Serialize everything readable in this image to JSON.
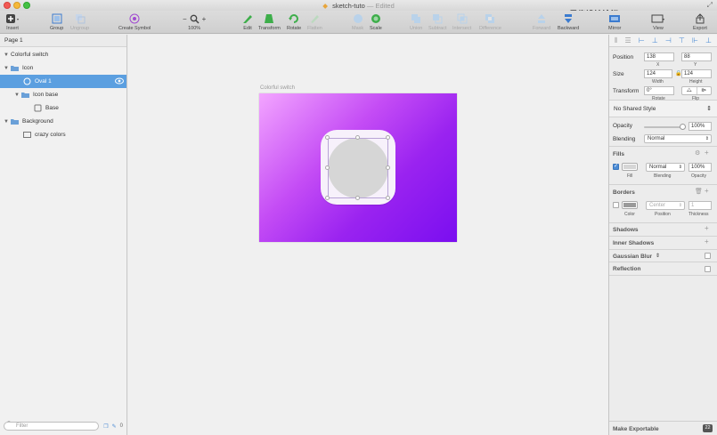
{
  "window": {
    "title": "sketch-tuto",
    "edited": "— Edited",
    "watermark": "思缘设计论坛  WWW.MISSYUAN.COM"
  },
  "toolbar": {
    "insert": "Insert",
    "group": "Group",
    "ungroup": "Ungroup",
    "create_symbol": "Create Symbol",
    "zoom_minus": "−",
    "zoom_plus": "+",
    "zoom": "100%",
    "edit": "Edit",
    "transform": "Transform",
    "rotate": "Rotate",
    "flatten": "Flatten",
    "mask": "Mask",
    "scale": "Scale",
    "union": "Union",
    "subtract": "Subtract",
    "intersect": "Intersect",
    "difference": "Difference",
    "forward": "Forward",
    "backward": "Backward",
    "mirror": "Mirror",
    "view": "View",
    "export": "Export"
  },
  "layers": {
    "page": "Page 1",
    "items": [
      {
        "label": "Colorful switch"
      },
      {
        "label": "Icon"
      },
      {
        "label": "Oval 1"
      },
      {
        "label": "Icon base"
      },
      {
        "label": "Base"
      },
      {
        "label": "Background"
      },
      {
        "label": "crazy colors"
      }
    ],
    "filter_placeholder": "Filter",
    "filter_count": "0"
  },
  "canvas": {
    "artboard_label": "Colorful switch",
    "colors": {
      "gradient_start": "#f3a5ff",
      "gradient_end": "#7a0ef0",
      "oval_fill": "#d6d6d6",
      "base_fill": "#f7f1fb"
    }
  },
  "inspector": {
    "position_label": "Position",
    "x": "138",
    "y": "88",
    "x_label": "X",
    "y_label": "Y",
    "size_label": "Size",
    "width": "124",
    "height": "124",
    "width_label": "Width",
    "height_label": "Height",
    "transform_label": "Transform",
    "rotate": "0°",
    "rotate_label": "Rotate",
    "flip_label": "Flip",
    "shared_style": "No Shared Style",
    "opacity_label": "Opacity",
    "opacity": "100%",
    "opacity_value": 1.0,
    "blending_label": "Blending",
    "blending": "Normal",
    "fills_label": "Fills",
    "fill_sublabel": "Fill",
    "fill_blending": "Normal",
    "fill_blending_label": "Blending",
    "fill_opacity": "100%",
    "fill_opacity_label": "Opacity",
    "borders_label": "Borders",
    "border_position": "Center",
    "border_thickness": "1",
    "color_label": "Color",
    "position_sublabel": "Position",
    "thickness_label": "Thickness",
    "shadows_label": "Shadows",
    "inner_shadows_label": "Inner Shadows",
    "gaussian_blur_label": "Gaussian Blur",
    "reflection_label": "Reflection",
    "make_exportable": "Make Exportable",
    "export_badge": "22"
  }
}
